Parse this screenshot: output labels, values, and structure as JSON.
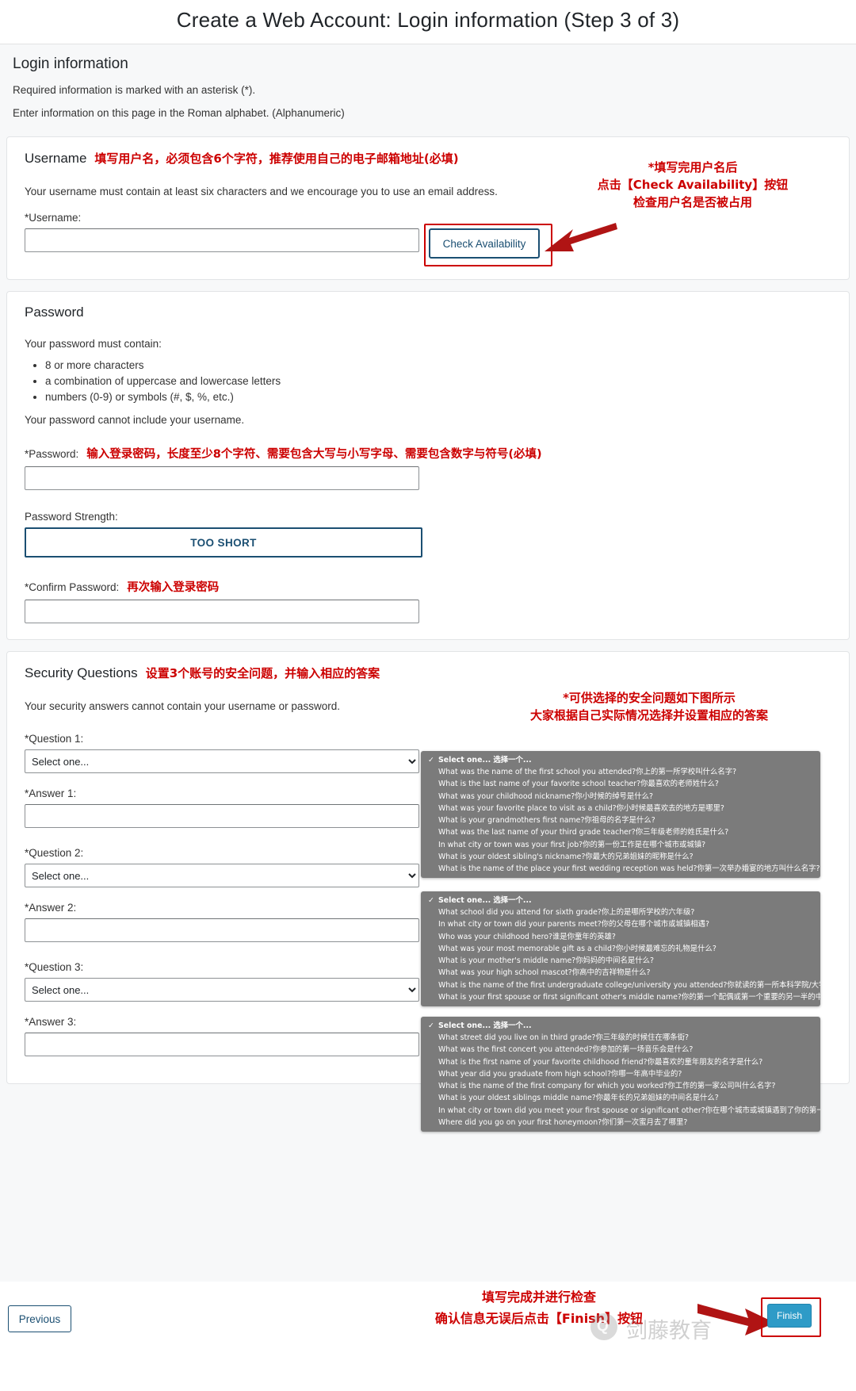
{
  "header": {
    "title": "Create a Web Account: Login information (Step 3 of 3)"
  },
  "intro": {
    "heading": "Login information",
    "line1": "Required information is marked with an asterisk (*).",
    "line2": "Enter information on this page in the Roman alphabet. (Alphanumeric)"
  },
  "username": {
    "heading": "Username",
    "annotation": "填写用户名，必须包含6个字符，推荐使用自己的电子邮箱地址(必填)",
    "hint": "Your username must contain at least six characters and we encourage you to use an email address.",
    "label": "*Username:",
    "value": "",
    "check_button": "Check Availability",
    "note_line1": "*填写完用户名后",
    "note_line2": "点击【Check Availability】按钮",
    "note_line3": "检查用户名是否被占用"
  },
  "password": {
    "heading": "Password",
    "must_contain_label": "Your password must contain:",
    "requirements": [
      "8 or more characters",
      "a combination of uppercase and lowercase letters",
      "numbers (0-9) or symbols (#, $, %, etc.)"
    ],
    "cannot_include": "Your password cannot include your username.",
    "label": "*Password:",
    "annotation": "输入登录密码，长度至少8个字符、需要包含大写与小写字母、需要包含数字与符号(必填)",
    "value": "",
    "strength_label": "Password Strength:",
    "strength_value": "TOO SHORT",
    "confirm_label": "*Confirm Password:",
    "confirm_annotation": "再次输入登录密码",
    "confirm_value": ""
  },
  "security": {
    "heading": "Security Questions",
    "annotation": "设置3个账号的安全问题，并输入相应的答案",
    "hint": "Your security answers cannot contain your username or password.",
    "note_line1": "*可供选择的安全问题如下图所示",
    "note_line2": "大家根据自己实际情况选择并设置相应的答案",
    "placeholder": "Select one...",
    "fields": [
      {
        "q_label": "*Question 1:",
        "q_value": "Select one...",
        "a_label": "*Answer 1:",
        "a_value": ""
      },
      {
        "q_label": "*Question 2:",
        "q_value": "Select one...",
        "a_label": "*Answer 2:",
        "a_value": ""
      },
      {
        "q_label": "*Question 3:",
        "q_value": "Select one...",
        "a_label": "*Answer 3:",
        "a_value": ""
      }
    ],
    "dropdowns": [
      {
        "selected": "Select one... 选择一个...",
        "options": [
          "What was the name of the first school you attended?你上的第一所学校叫什么名字?",
          "What is the last name of your favorite school teacher?你最喜欢的老师姓什么?",
          "What was your childhood nickname?你小时候的绰号是什么?",
          "What was your favorite place to visit as a child?你小时候最喜欢去的地方是哪里?",
          "What is your grandmothers first name?你祖母的名字是什么?",
          "What was the last name of your third grade teacher?你三年级老师的姓氏是什么?",
          "In what city or town was your first job?你的第一份工作是在哪个城市或城镇?",
          "What is your oldest sibling's nickname?你最大的兄弟姐妹的昵称是什么?",
          "What is the name of the place your first wedding reception was held?你第一次举办婚宴的地方叫什么名字?"
        ]
      },
      {
        "selected": "Select one... 选择一个...",
        "options": [
          "What school did you attend for sixth grade?你上的是哪所学校的六年级?",
          "In what city or town did your parents meet?你的父母在哪个城市或城镇相遇?",
          "Who was your childhood hero?谁是你童年的英雄?",
          "What was your most memorable gift as a child?你小时候最难忘的礼物是什么?",
          "What is your mother's middle name?你妈妈的中间名是什么?",
          "What was your high school mascot?你高中的吉祥物是什么?",
          "What is the name of the first undergraduate college/university you attended?你就读的第一所本科学院/大学的名称是什么?",
          "What is your first spouse or first significant other's middle name?你的第一个配偶或第一个重要的另一半的中间名是什么?"
        ]
      },
      {
        "selected": "Select one... 选择一个...",
        "options": [
          "What street did you live on in third grade?你三年级的时候住在哪条街?",
          "What was the first concert you attended?你参加的第一场音乐会是什么?",
          "What is the first name of your favorite childhood friend?你最喜欢的童年朋友的名字是什么?",
          "What year did you graduate from high school?你哪一年高中毕业的?",
          "What is the name of the first company for which you worked?你工作的第一家公司叫什么名字?",
          "What is your oldest siblings middle name?你最年长的兄弟姐妹的中间名是什么?",
          "In what city or town did you meet your first spouse or significant other?你在哪个城市或城镇遇到了你的第一任配偶或另一半?",
          "Where did you go on your first honeymoon?你们第一次蜜月去了哪里?"
        ]
      }
    ]
  },
  "footer": {
    "previous": "Previous",
    "finish": "Finish",
    "note_line1": "填写完成并进行检查",
    "note_line2": "确认信息无误后点击【Finish】按钮",
    "watermark": "剑藤教育"
  },
  "colors": {
    "annotation_red": "#cc0000",
    "accent_blue": "#1b4f72",
    "finish_blue": "#2e9bc7",
    "dropdown_bg": "#7b7b7b"
  }
}
